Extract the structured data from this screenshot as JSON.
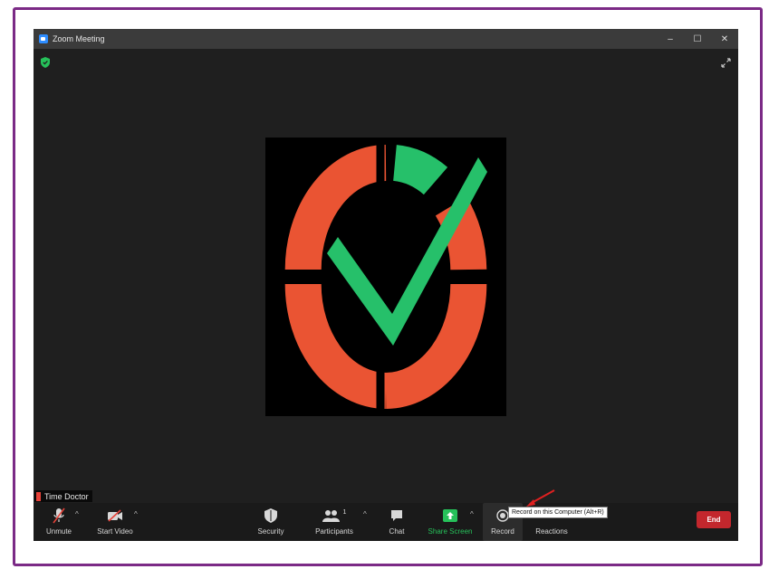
{
  "window": {
    "title": "Zoom Meeting",
    "controls": {
      "minimize": "–",
      "maximize": "☐",
      "close": "✕"
    }
  },
  "participant": {
    "name": "Time Doctor"
  },
  "toolbar": {
    "unmute": "Unmute",
    "start_video": "Start Video",
    "security": "Security",
    "participants": "Participants",
    "participants_count": "1",
    "chat": "Chat",
    "share_screen": "Share Screen",
    "record": "Record",
    "reactions": "Reactions",
    "end": "End",
    "caret": "^"
  },
  "tooltip": {
    "text": "Record on this Computer (Alt+R)"
  },
  "colors": {
    "logo_orange": "#ea5433",
    "logo_green": "#26c06a",
    "share_green": "#26c15a",
    "end_red": "#c3272d",
    "frame_purple": "#7b2a86",
    "annotation_red": "#e02020"
  },
  "icons": [
    "zoom-app-icon",
    "shield-icon",
    "fullscreen-icon",
    "mic-off-icon",
    "video-off-icon",
    "security-shield-icon",
    "participants-icon",
    "chat-icon",
    "share-screen-icon",
    "record-icon",
    "reactions-icon",
    "annotation-arrow-icon"
  ]
}
